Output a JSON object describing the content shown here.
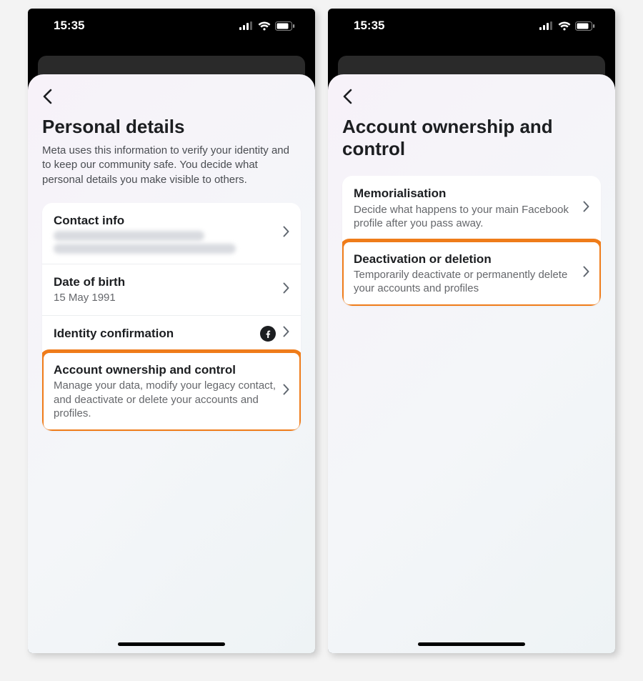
{
  "status": {
    "time": "15:35"
  },
  "left": {
    "title": "Personal details",
    "subtitle": "Meta uses this information to verify your identity and to keep our community safe. You decide what personal details you make visible to others.",
    "rows": {
      "contact": {
        "title": "Contact info"
      },
      "dob": {
        "title": "Date of birth",
        "sub": "15 May 1991"
      },
      "identity": {
        "title": "Identity confirmation"
      },
      "ownership": {
        "title": "Account ownership and control",
        "sub": "Manage your data, modify your legacy contact, and deactivate or delete your accounts and profiles."
      }
    }
  },
  "right": {
    "title": "Account ownership and control",
    "rows": {
      "memorial": {
        "title": "Memorialisation",
        "sub": "Decide what happens to your main Facebook profile after you pass away."
      },
      "deactivate": {
        "title": "Deactivation or deletion",
        "sub": "Temporarily deactivate or permanently delete your accounts and profiles"
      }
    }
  }
}
